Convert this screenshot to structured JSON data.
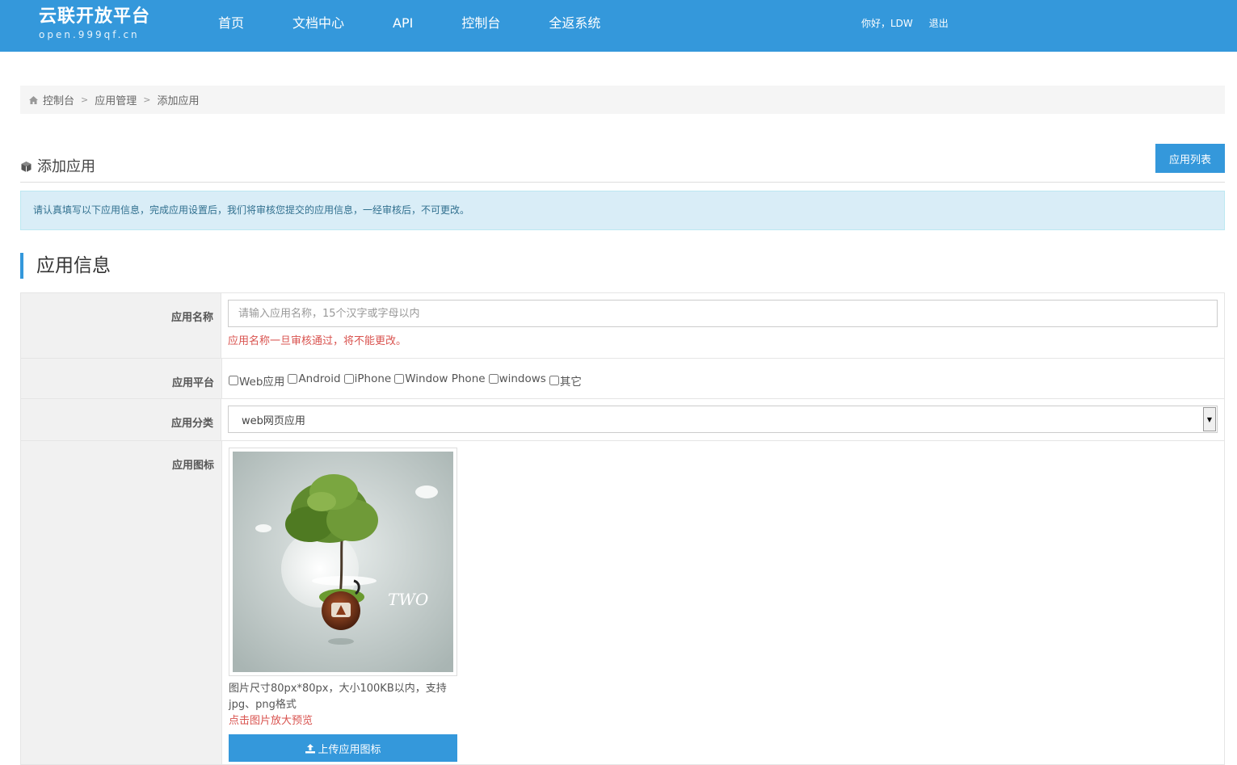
{
  "header": {
    "logo_title": "云联开放平台",
    "logo_sub": "open.999qf.cn",
    "nav": [
      "首页",
      "文档中心",
      "API",
      "控制台",
      "全返系统"
    ],
    "greeting": "你好，LDW",
    "logout": "退出"
  },
  "breadcrumb": {
    "home_icon": "home-icon",
    "items": [
      "控制台",
      "应用管理",
      "添加应用"
    ],
    "separator": ">"
  },
  "page": {
    "title": "添加应用",
    "title_icon": "cube-icon",
    "list_button": "应用列表",
    "notice": "请认真填写以下应用信息，完成应用设置后，我们将审核您提交的应用信息，一经审核后，不可更改。"
  },
  "section": {
    "title": "应用信息"
  },
  "form": {
    "name_label": "应用名称",
    "name_placeholder": "请输入应用名称，15个汉字或字母以内",
    "name_warning": "应用名称一旦审核通过，将不能更改。",
    "platform_label": "应用平台",
    "platforms": [
      "Web应用",
      "Android",
      "iPhone",
      "Window Phone",
      "windows",
      "其它"
    ],
    "category_label": "应用分类",
    "category_value": "web网页应用",
    "icon_label": "应用图标",
    "icon_hint": "图片尺寸80px*80px，大小100KB以内，支持jpg、png格式",
    "icon_preview_hint": "点击图片放大预览",
    "upload_button": "上传应用图标",
    "upload_icon": "upload-icon",
    "art_text": "TWO"
  },
  "colors": {
    "brand": "#3498db",
    "danger": "#d9534f",
    "info_bg": "#d9edf7"
  }
}
